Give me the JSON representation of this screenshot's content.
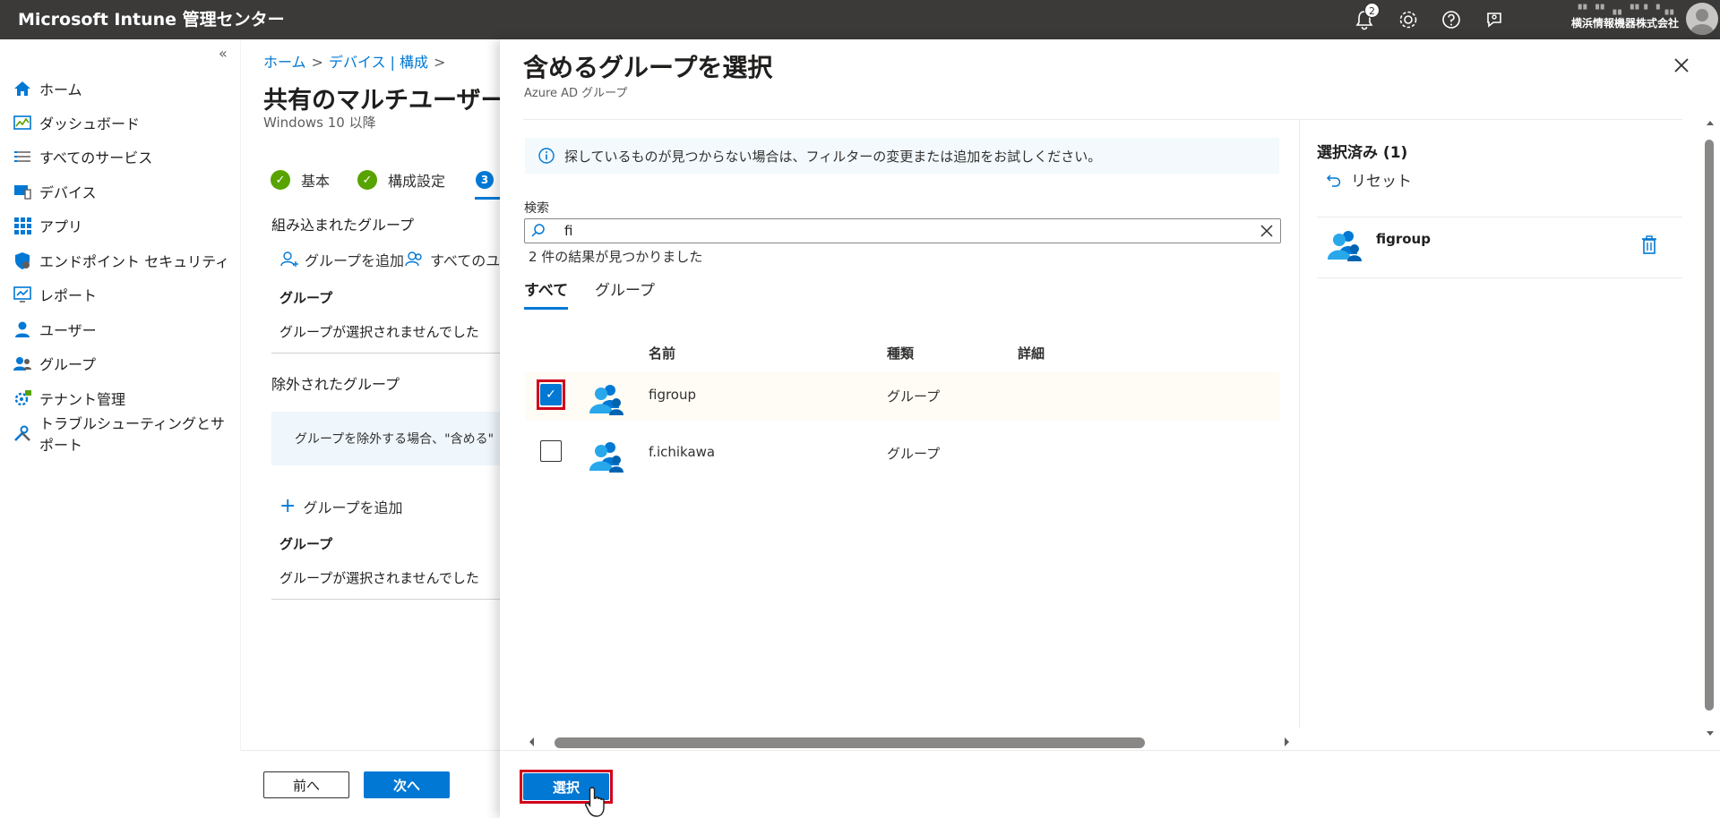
{
  "app": {
    "title": "Microsoft Intune 管理センター"
  },
  "topbar": {
    "notification_count": "2",
    "user_name_blur": "▝▘▝▘▗▖▝▘▘▝▗▖",
    "org": "横浜情報機器株式会社"
  },
  "sidenav": {
    "items": [
      {
        "label": "ホーム",
        "icon": "home-icon"
      },
      {
        "label": "ダッシュボード",
        "icon": "dashboard-icon"
      },
      {
        "label": "すべてのサービス",
        "icon": "list-icon"
      },
      {
        "label": "デバイス",
        "icon": "device-icon"
      },
      {
        "label": "アプリ",
        "icon": "apps-icon"
      },
      {
        "label": "エンドポイント セキュリティ",
        "icon": "shield-icon"
      },
      {
        "label": "レポート",
        "icon": "report-icon"
      },
      {
        "label": "ユーザー",
        "icon": "user-icon"
      },
      {
        "label": "グループ",
        "icon": "group-icon"
      },
      {
        "label": "テナント管理",
        "icon": "tenant-icon"
      },
      {
        "label": "トラブルシューティングとサポート",
        "icon": "wrench-icon"
      }
    ]
  },
  "breadcrumb": {
    "home": "ホーム",
    "devices": "デバイス | 構成"
  },
  "page": {
    "title": "共有のマルチユーザーの",
    "subtitle": "Windows 10 以降"
  },
  "steps": {
    "s1": "基本",
    "s2": "構成設定",
    "s3": "3"
  },
  "assign": {
    "included_title": "組み込まれたグループ",
    "add_group": "グループを追加",
    "add_all_users": "すべてのユー",
    "group_header": "グループ",
    "no_group": "グループが選択されませんでした",
    "excluded_title": "除外されたグループ",
    "exclude_info": "グループを除外する場合、\"含める\" と",
    "add_group2": "グループを追加",
    "group_header2": "グループ",
    "no_group2": "グループが選択されませんでした"
  },
  "footer": {
    "prev": "前へ",
    "next": "次へ"
  },
  "blade": {
    "title": "含めるグループを選択",
    "subtitle": "Azure AD グループ",
    "info": "探しているものが見つからない場合は、フィルターの変更または追加をお試しください。",
    "search_label": "検索",
    "search_value": "fi",
    "result_count": "2 件の結果が見つかりました",
    "tabs": [
      "すべて",
      "グループ"
    ],
    "columns": {
      "name": "名前",
      "type": "種類",
      "detail": "詳細"
    },
    "rows": [
      {
        "name": "figroup",
        "type": "グループ",
        "checked": true
      },
      {
        "name": "f.ichikawa",
        "type": "グループ",
        "checked": false
      }
    ],
    "selected_title": "選択済み (1)",
    "reset": "リセット",
    "selected_items": [
      {
        "name": "figroup"
      }
    ],
    "select_button": "選択"
  },
  "colors": {
    "accent": "#0078d4",
    "highlight": "#d0021b",
    "topbar": "#3b3a39",
    "success": "#57a300"
  }
}
